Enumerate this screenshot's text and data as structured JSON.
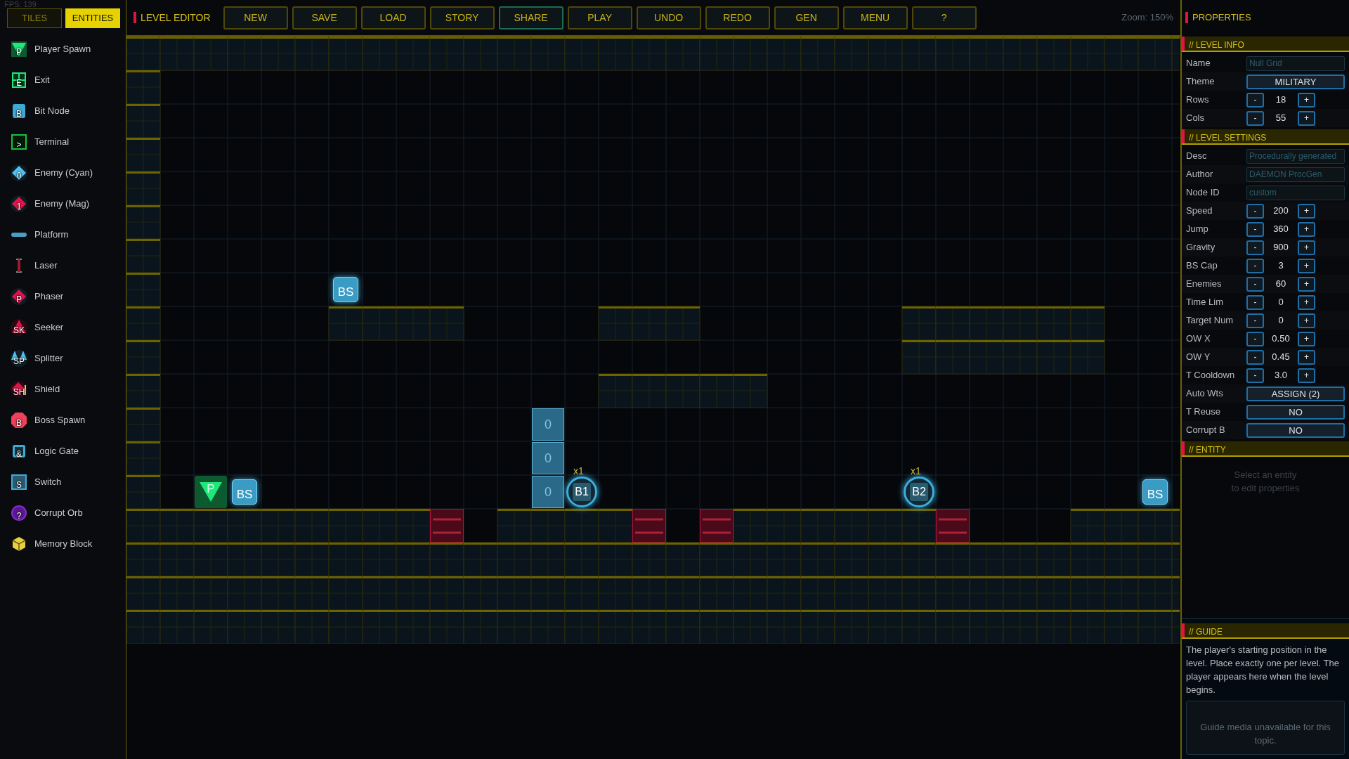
{
  "fps": "FPS: 139",
  "mode_tabs": [
    {
      "label": "TILES",
      "selected": false
    },
    {
      "label": "ENTITIES",
      "selected": true
    }
  ],
  "palette": [
    {
      "kind": "player",
      "glyph": "P",
      "label": "Player Spawn",
      "color": "#1ee87a"
    },
    {
      "kind": "exit",
      "glyph": "E",
      "label": "Exit",
      "color": "#1ee87a"
    },
    {
      "kind": "node",
      "glyph": "B",
      "label": "Bit Node",
      "color": "#3fa9d6"
    },
    {
      "kind": "terminal",
      "glyph": ">",
      "label": "Terminal",
      "color": "#18c040"
    },
    {
      "kind": "diamond",
      "glyph": "0",
      "label": "Enemy (Cyan)",
      "color": "#4fc3f0"
    },
    {
      "kind": "diamond",
      "glyph": "1",
      "label": "Enemy (Mag)",
      "color": "#e0144a"
    },
    {
      "kind": "platform",
      "label": "Platform",
      "color": "#4a9ec4"
    },
    {
      "kind": "laser",
      "label": "Laser",
      "color": "#a01830"
    },
    {
      "kind": "diamond",
      "glyph": "P",
      "label": "Phaser",
      "color": "#e0144a"
    },
    {
      "kind": "triangle",
      "glyph": "SK",
      "label": "Seeker",
      "color": "#e0144a"
    },
    {
      "kind": "split",
      "glyph": "SP",
      "label": "Splitter",
      "color": "#4fc3f0"
    },
    {
      "kind": "shield",
      "glyph": "SH",
      "label": "Shield",
      "color": "#e0144a"
    },
    {
      "kind": "boss",
      "glyph": "B",
      "label": "Boss Spawn",
      "color": "#f0405a"
    },
    {
      "kind": "gate",
      "glyph": "&",
      "label": "Logic Gate",
      "color": "#3fa9d6"
    },
    {
      "kind": "switch",
      "glyph": "S",
      "label": "Switch",
      "color": "#3fa9d6"
    },
    {
      "kind": "orb",
      "glyph": "?",
      "label": "Corrupt Orb",
      "color": "#8a2ad0"
    },
    {
      "kind": "cube",
      "label": "Memory Block",
      "color": "#e6d040"
    }
  ],
  "toolbar": {
    "title": "LEVEL EDITOR",
    "buttons": [
      {
        "label": "NEW",
        "active": false
      },
      {
        "label": "SAVE",
        "active": false
      },
      {
        "label": "LOAD",
        "active": false
      },
      {
        "label": "STORY",
        "active": false
      },
      {
        "label": "SHARE",
        "active": true
      },
      {
        "label": "PLAY",
        "active": false
      },
      {
        "label": "UNDO",
        "active": false
      },
      {
        "label": "REDO",
        "active": false
      },
      {
        "label": "GEN",
        "active": false
      },
      {
        "label": "MENU",
        "active": false
      },
      {
        "label": "?",
        "active": false
      }
    ],
    "zoom": "Zoom: 150%"
  },
  "map_entities": [
    {
      "kind": "boss-spawn",
      "label": "BS"
    },
    {
      "kind": "bit-block",
      "label": "0"
    },
    {
      "kind": "bit-block",
      "label": "0"
    },
    {
      "kind": "player",
      "label": "P"
    },
    {
      "kind": "boss-spawn",
      "label": "BS"
    },
    {
      "kind": "bit-block",
      "label": "0"
    },
    {
      "kind": "bit-node",
      "label": "B1",
      "count": "x1"
    },
    {
      "kind": "bit-node",
      "label": "B2",
      "count": "x1"
    },
    {
      "kind": "boss-spawn",
      "label": "BS"
    }
  ],
  "properties": {
    "title": "PROPERTIES",
    "sections": [
      {
        "title": "// LEVEL INFO",
        "rows": [
          {
            "kind": "text",
            "label": "Name",
            "placeholder": "Null Grid"
          },
          {
            "kind": "button",
            "label": "Theme",
            "value": "MILITARY"
          },
          {
            "kind": "stepper",
            "label": "Rows",
            "value": "18",
            "minus": "-",
            "plus": "+"
          },
          {
            "kind": "stepper",
            "label": "Cols",
            "value": "55",
            "minus": "-",
            "plus": "+"
          }
        ]
      },
      {
        "title": "// LEVEL SETTINGS",
        "rows": [
          {
            "kind": "text",
            "label": "Desc",
            "placeholder": "Procedurally generated"
          },
          {
            "kind": "text",
            "label": "Author",
            "placeholder": "DAEMON ProcGen"
          },
          {
            "kind": "text",
            "label": "Node ID",
            "placeholder": "custom"
          },
          {
            "kind": "stepper",
            "label": "Speed",
            "value": "200",
            "minus": "-",
            "plus": "+"
          },
          {
            "kind": "stepper",
            "label": "Jump",
            "value": "360",
            "minus": "-",
            "plus": "+"
          },
          {
            "kind": "stepper",
            "label": "Gravity",
            "value": "900",
            "minus": "-",
            "plus": "+"
          },
          {
            "kind": "stepper",
            "label": "BS Cap",
            "value": "3",
            "minus": "-",
            "plus": "+"
          },
          {
            "kind": "stepper",
            "label": "Enemies",
            "value": "60",
            "minus": "-",
            "plus": "+"
          },
          {
            "kind": "stepper",
            "label": "Time Lim",
            "value": "0",
            "minus": "-",
            "plus": "+"
          },
          {
            "kind": "stepper",
            "label": "Target Num",
            "value": "0",
            "minus": "-",
            "plus": "+"
          },
          {
            "kind": "stepper",
            "label": "OW X",
            "value": "0.50",
            "minus": "-",
            "plus": "+"
          },
          {
            "kind": "stepper",
            "label": "OW Y",
            "value": "0.45",
            "minus": "-",
            "plus": "+"
          },
          {
            "kind": "stepper",
            "label": "T Cooldown",
            "value": "3.0",
            "minus": "-",
            "plus": "+"
          },
          {
            "kind": "button",
            "label": "Auto Wts",
            "value": "ASSIGN (2)"
          },
          {
            "kind": "button",
            "label": "T Reuse",
            "value": "NO"
          },
          {
            "kind": "button",
            "label": "Corrupt B",
            "value": "NO"
          }
        ]
      },
      {
        "title": "// ENTITY",
        "hint": [
          "Select an entity",
          "to edit properties"
        ]
      }
    ]
  },
  "guide": {
    "title": "// GUIDE",
    "text": "The player's starting position in the level. Place exactly one per level. The player appears here when the level begins.",
    "media": "Guide media unavailable for this topic."
  }
}
